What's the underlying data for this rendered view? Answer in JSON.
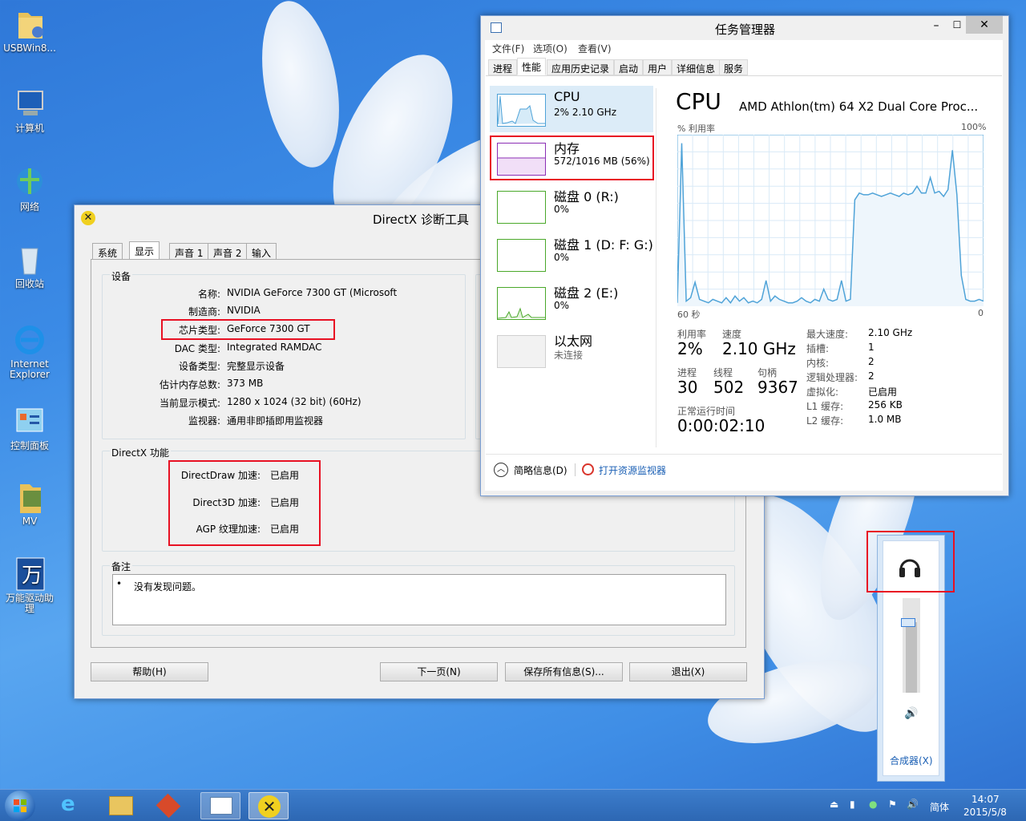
{
  "desktop": {
    "icons": [
      "USBWin8...",
      "计算机",
      "网络",
      "回收站",
      "Internet Explorer",
      "控制面板",
      "MV",
      "万能驱动助理"
    ]
  },
  "dxdiag": {
    "title": "DirectX 诊断工具",
    "tabs": [
      "系统",
      "显示",
      "声音 1",
      "声音 2",
      "输入"
    ],
    "device_group": "设备",
    "rows": [
      {
        "label": "名称:",
        "value": "NVIDIA GeForce 7300 GT (Microsoft"
      },
      {
        "label": "制造商:",
        "value": "NVIDIA"
      },
      {
        "label": "芯片类型:",
        "value": "GeForce 7300 GT"
      },
      {
        "label": "DAC 类型:",
        "value": "Integrated RAMDAC"
      },
      {
        "label": "设备类型:",
        "value": "完整显示设备"
      },
      {
        "label": "估计内存总数:",
        "value": "373 MB"
      },
      {
        "label": "当前显示模式:",
        "value": "1280 x 1024 (32 bit) (60Hz)"
      },
      {
        "label": "监视器:",
        "value": "通用非即插即用监视器"
      }
    ],
    "features_group": "DirectX 功能",
    "features": [
      {
        "label": "DirectDraw 加速:",
        "value": "已启用"
      },
      {
        "label": "Direct3D 加速:",
        "value": "已启用"
      },
      {
        "label": "AGP 纹理加速:",
        "value": "已启用"
      }
    ],
    "notes_group": "备注",
    "notes": "没有发现问题。",
    "buttons": {
      "help": "帮助(H)",
      "next": "下一页(N)",
      "save": "保存所有信息(S)...",
      "exit": "退出(X)"
    }
  },
  "taskmgr": {
    "title": "任务管理器",
    "menu": [
      "文件(F)",
      "选项(O)",
      "查看(V)"
    ],
    "tabs": [
      "进程",
      "性能",
      "应用历史记录",
      "启动",
      "用户",
      "详细信息",
      "服务"
    ],
    "sidebar": [
      {
        "name": "CPU",
        "value": "2% 2.10 GHz"
      },
      {
        "name": "内存",
        "value": "572/1016 MB (56%)"
      },
      {
        "name": "磁盘 0 (R:)",
        "value": "0%"
      },
      {
        "name": "磁盘 1 (D: F: G:)",
        "value": "0%"
      },
      {
        "name": "磁盘 2 (E:)",
        "value": "0%"
      },
      {
        "name": "以太网",
        "value": "未连接"
      }
    ],
    "heading": "CPU",
    "processor": "AMD Athlon(tm) 64 X2 Dual Core Proc...",
    "graph": {
      "ylabel": "% 利用率",
      "ymax_label": "100%",
      "xlabel": "60 秒",
      "xmin_label": "0",
      "values": [
        2,
        95,
        3,
        5,
        14,
        4,
        3,
        2,
        4,
        3,
        2,
        5,
        2,
        6,
        3,
        5,
        2,
        3,
        2,
        4,
        15,
        3,
        6,
        4,
        3,
        2,
        2,
        3,
        5,
        3,
        2,
        4,
        3,
        10,
        4,
        3,
        4,
        15,
        3,
        4,
        62,
        66,
        65,
        65,
        66,
        65,
        64,
        65,
        66,
        65,
        64,
        66,
        65,
        66,
        70,
        66,
        66,
        75,
        66,
        67,
        64,
        68,
        91,
        65,
        18,
        4,
        3,
        3,
        4,
        3
      ]
    },
    "stats": {
      "util_label": "利用率",
      "util": "2%",
      "speed_label": "速度",
      "speed": "2.10 GHz",
      "proc_label": "进程",
      "proc": "30",
      "thread_label": "线程",
      "thread": "502",
      "handle_label": "句柄",
      "handle": "9367",
      "uptime_label": "正常运行时间",
      "uptime": "0:00:02:10"
    },
    "specs": [
      {
        "label": "最大速度:",
        "value": "2.10 GHz"
      },
      {
        "label": "插槽:",
        "value": "1"
      },
      {
        "label": "内核:",
        "value": "2"
      },
      {
        "label": "逻辑处理器:",
        "value": "2"
      },
      {
        "label": "虚拟化:",
        "value": "已启用"
      },
      {
        "label": "L1 缓存:",
        "value": "256 KB"
      },
      {
        "label": "L2 缓存:",
        "value": "1.0 MB"
      }
    ],
    "footer": {
      "brief": "简略信息(D)",
      "resmon": "打开资源监视器"
    }
  },
  "volume": {
    "mixer": "合成器(X)",
    "level_percent": 75
  },
  "taskbar": {
    "lang": "简体",
    "time": "14:07",
    "date": "2015/5/8"
  },
  "colors": {
    "accent": "#3b8be6",
    "highlight": "#e81123",
    "cpu_line": "#4fa3d8",
    "mem_line": "#8b2fb5",
    "disk_line": "#4aa82a"
  }
}
